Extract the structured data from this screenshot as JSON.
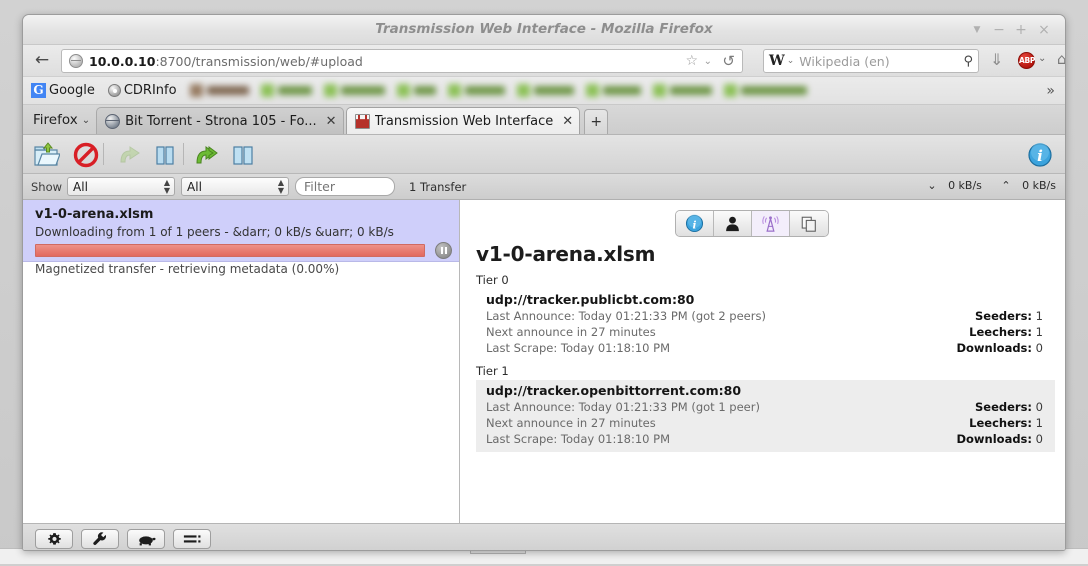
{
  "window": {
    "title": "Transmission Web Interface - Mozilla Firefox",
    "controls": {
      "shade": "▼",
      "minimize": "−",
      "maximize": "+",
      "close": "×"
    }
  },
  "navbar": {
    "back_glyph": "←",
    "url_host": "10.0.0.10",
    "url_rest": ":8700/transmission/web/#upload",
    "url_full": "10.0.0.10:8700/transmission/web/#upload",
    "star_glyph": "☆",
    "chevron_glyph": "⌄",
    "reload_glyph": "↺",
    "search_engine_letter": "W",
    "search_placeholder": "Wikipedia (en)",
    "search_magnifier": "⚲",
    "download_glyph": "⇓",
    "abp_label": "ABP",
    "home_glyph": "⌂"
  },
  "bookmarks": {
    "items": [
      {
        "label": "Google",
        "icon": "google-icon"
      },
      {
        "label": "CDRInfo",
        "icon": "cdrinfo-icon"
      }
    ],
    "redacted_count": 9,
    "overflow_glyph": "»"
  },
  "tabstrip": {
    "firefox_menu": "Firefox",
    "menu_chevron": "⌄",
    "tabs": [
      {
        "label": "Bit Torrent - Strona 105 - Fo...",
        "icon": "globe-icon",
        "active": false,
        "close": "✕"
      },
      {
        "label": "Transmission Web Interface",
        "icon": "transmission-icon",
        "active": true,
        "close": "✕"
      }
    ],
    "new_tab_glyph": "+"
  },
  "transmission": {
    "toolbar": {
      "open_label": "Open Torrent",
      "remove_label": "Remove",
      "start_label": "Start",
      "pause_label": "Pause",
      "start_all_label": "Start All",
      "pause_all_label": "Pause All",
      "info_label": "Toggle Inspector"
    },
    "filterbar": {
      "show_label": "Show",
      "status_filter": "All",
      "tracker_filter": "All",
      "filter_placeholder": "Filter",
      "filter_value": "",
      "transfer_count": "1 Transfer",
      "download_speed": "0 kB/s",
      "upload_speed": "0 kB/s",
      "down_glyph": "⌄",
      "up_glyph": "⌃"
    },
    "torrents": [
      {
        "name": "v1-0-arena.xlsm",
        "status": "Downloading from 1 of 1 peers - &darr; 0 kB/s &uarr; 0 kB/s",
        "meta": "Magnetized transfer - retrieving metadata (0.00%)",
        "progress_percent": 0,
        "progress_color": "#e87c72",
        "selected": true
      }
    ],
    "inspector": {
      "tabs": [
        {
          "name": "info-tab",
          "icon": "info-icon",
          "active": false
        },
        {
          "name": "peers-tab",
          "icon": "person-icon",
          "active": false
        },
        {
          "name": "trackers-tab",
          "icon": "tracker-tower-icon",
          "active": true
        },
        {
          "name": "files-tab",
          "icon": "files-icon",
          "active": false
        }
      ],
      "title": "v1-0-arena.xlsm",
      "tiers": [
        {
          "label": "Tier 0",
          "alt": false,
          "tracker": {
            "url": "udp://tracker.publicbt.com:80",
            "last_announce": "Last Announce: Today 01:21:33 PM (got 2 peers)",
            "next_announce": "Next announce in 27 minutes",
            "last_scrape": "Last Scrape: Today 01:18:10 PM",
            "seeders_label": "Seeders:",
            "seeders": "1",
            "leechers_label": "Leechers:",
            "leechers": "1",
            "downloads_label": "Downloads:",
            "downloads": "0"
          }
        },
        {
          "label": "Tier 1",
          "alt": true,
          "tracker": {
            "url": "udp://tracker.openbittorrent.com:80",
            "last_announce": "Last Announce: Today 01:21:33 PM (got 1 peer)",
            "next_announce": "Next announce in 27 minutes",
            "last_scrape": "Last Scrape: Today 01:18:10 PM",
            "seeders_label": "Seeders:",
            "seeders": "0",
            "leechers_label": "Leechers:",
            "leechers": "1",
            "downloads_label": "Downloads:",
            "downloads": "0"
          }
        }
      ]
    },
    "statusbar": {
      "buttons": [
        {
          "name": "preferences-button",
          "icon": "gear-icon"
        },
        {
          "name": "settings-button",
          "icon": "wrench-icon"
        },
        {
          "name": "alt-speed-button",
          "icon": "turtle-icon"
        },
        {
          "name": "list-options-button",
          "icon": "list-icon"
        }
      ]
    }
  }
}
